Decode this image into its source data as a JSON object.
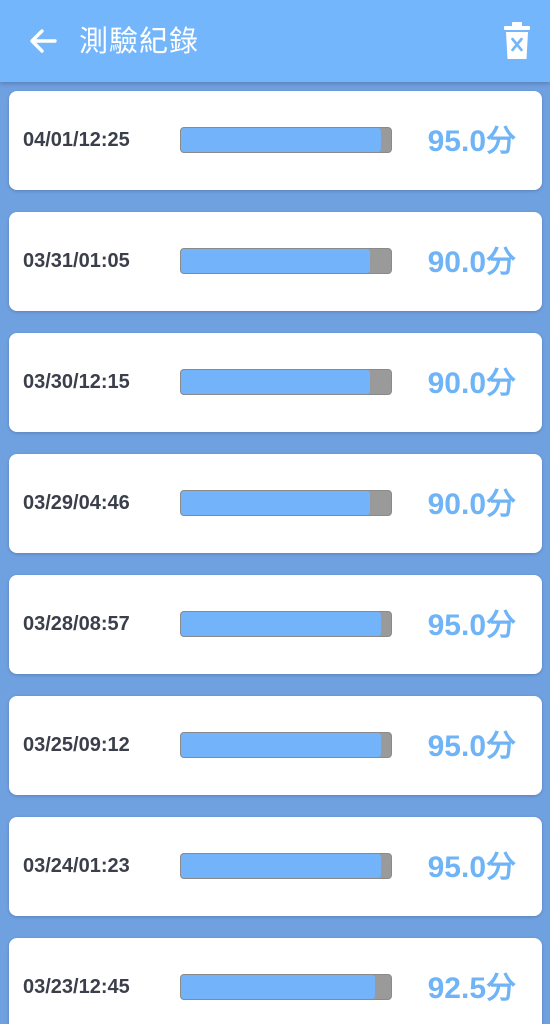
{
  "app_bar": {
    "title": "測驗紀錄",
    "back_icon": "arrow-left-icon",
    "delete_icon": "trash-icon",
    "background": "#74b6fb"
  },
  "colors": {
    "page_bg": "#6fa0e0",
    "bar_fill": "#72b3fa",
    "bar_track": "#9a9a9a",
    "score_text": "#6fb4f6",
    "date_text": "#3b3f4b"
  },
  "records": [
    {
      "date": "04/01/12:25",
      "score": "95.0分",
      "progress": 0.95
    },
    {
      "date": "03/31/01:05",
      "score": "90.0分",
      "progress": 0.9
    },
    {
      "date": "03/30/12:15",
      "score": "90.0分",
      "progress": 0.9
    },
    {
      "date": "03/29/04:46",
      "score": "90.0分",
      "progress": 0.9
    },
    {
      "date": "03/28/08:57",
      "score": "95.0分",
      "progress": 0.95
    },
    {
      "date": "03/25/09:12",
      "score": "95.0分",
      "progress": 0.95
    },
    {
      "date": "03/24/01:23",
      "score": "95.0分",
      "progress": 0.95
    },
    {
      "date": "03/23/12:45",
      "score": "92.5分",
      "progress": 0.925
    }
  ]
}
